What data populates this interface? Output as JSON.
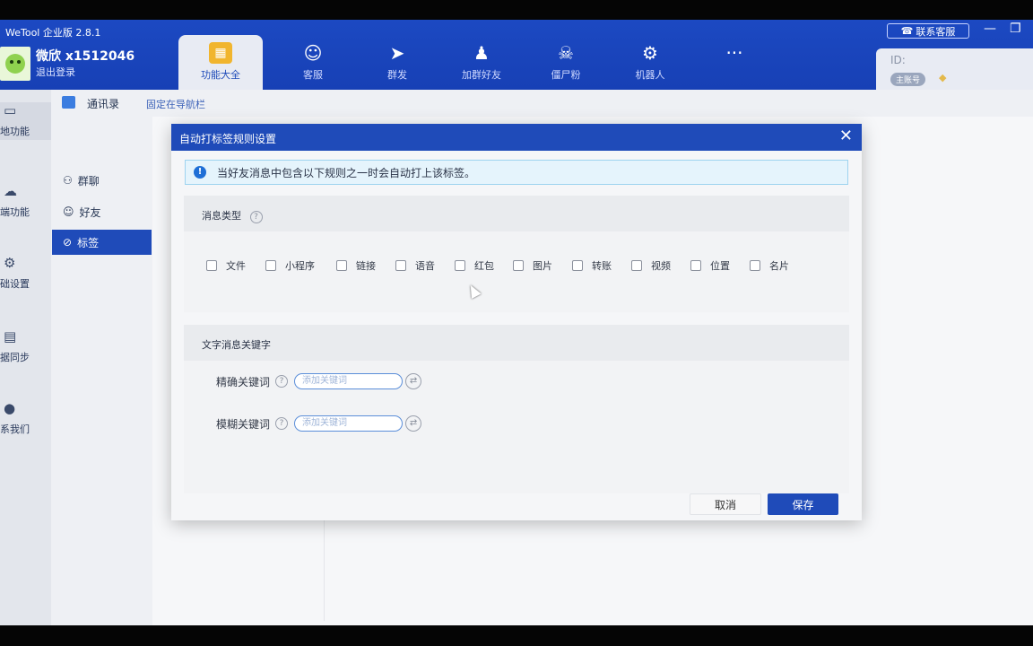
{
  "app": {
    "title": "WeTool 企业版 2.8.1"
  },
  "user": {
    "name": "微欣 x1512046",
    "logout": "退出登录"
  },
  "nav_tabs": [
    {
      "label": "功能大全",
      "icon": "grid-icon"
    },
    {
      "label": "客服",
      "icon": "headset-icon"
    },
    {
      "label": "群发",
      "icon": "send-icon"
    },
    {
      "label": "加群好友",
      "icon": "add-friend-icon"
    },
    {
      "label": "僵尸粉",
      "icon": "skull-icon"
    },
    {
      "label": "机器人",
      "icon": "robot-icon"
    },
    {
      "label": "",
      "icon": "more-icon"
    }
  ],
  "window": {
    "contact_label": "联系客服",
    "id_label": "ID:",
    "main_account_badge": "主账号"
  },
  "sidebar": {
    "items": [
      {
        "label": "地功能",
        "icon": "monitor-icon"
      },
      {
        "label": "端功能",
        "icon": "cloud-icon"
      },
      {
        "label": "础设置",
        "icon": "gear-icon"
      },
      {
        "label": "据同步",
        "icon": "sync-icon"
      },
      {
        "label": "系我们",
        "icon": "user-icon"
      }
    ]
  },
  "subbar": {
    "title": "通讯录",
    "pin": "固定在导航栏"
  },
  "secondary_menu": {
    "items": [
      {
        "label": "群聊",
        "icon": "group-icon"
      },
      {
        "label": "好友",
        "icon": "friend-icon"
      },
      {
        "label": "标签",
        "icon": "tag-icon"
      }
    ]
  },
  "dialog": {
    "title": "自动打标签规则设置",
    "info": "当好友消息中包含以下规则之一时会自动打上该标签。",
    "message_type": {
      "title": "消息类型",
      "options": [
        "文件",
        "小程序",
        "链接",
        "语音",
        "红包",
        "图片",
        "转账",
        "视频",
        "位置",
        "名片"
      ]
    },
    "keywords": {
      "title": "文字消息关键字",
      "exact_label": "精确关键词",
      "exact_placeholder": "添加关键词",
      "fuzzy_label": "模糊关键词",
      "fuzzy_placeholder": "添加关键词"
    },
    "cancel": "取消",
    "save": "保存"
  }
}
